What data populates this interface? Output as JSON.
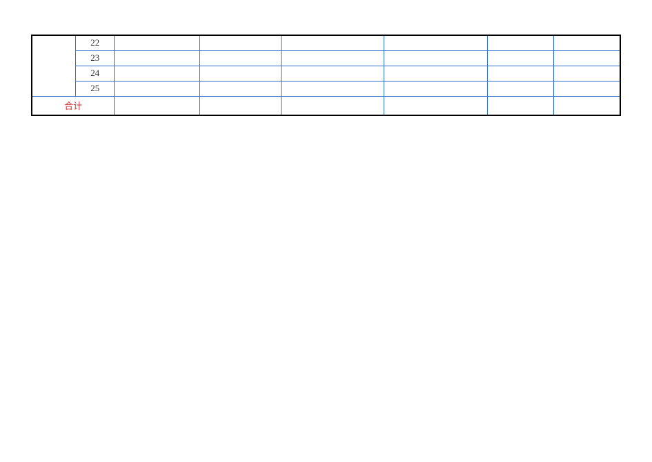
{
  "table": {
    "rows": [
      {
        "num": "22"
      },
      {
        "num": "23"
      },
      {
        "num": "24"
      },
      {
        "num": "25"
      }
    ],
    "total_label": "合计"
  }
}
